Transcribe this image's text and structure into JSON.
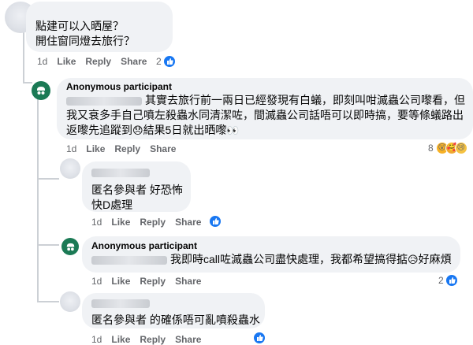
{
  "comments": [
    {
      "lines": [
        "點建可以入晒屋？",
        "開住窗同燈去旅行？"
      ],
      "actions": {
        "time": "1d",
        "like": "Like",
        "reply": "Reply",
        "share": "Share"
      },
      "reaction_count": "2",
      "reaction_icons": [
        "like-icon"
      ]
    },
    {
      "author": "Anonymous participant",
      "lines": [
        "其實去旅行前一兩日已經發現有白蟻，即刻叫咁滅蟲公司嚟看，但",
        "我又衰多手自己噴左殺蟲水同清潔咗，間滅蟲公司話唔可以即時搞，要等條蟻路出",
        "返嚟先追蹤到",
        "結果5日就出晒嚟"
      ],
      "actions": {
        "time": "1d",
        "like": "Like",
        "reply": "Reply",
        "share": "Share"
      },
      "reaction_count": "8",
      "reaction_icons": [
        "wow-icon",
        "care-icon",
        "sad-icon"
      ]
    },
    {
      "lines": [
        "匿名參與者 好恐怖",
        "快D處理"
      ],
      "actions": {
        "time": "1d",
        "like": "Like",
        "reply": "Reply",
        "share": "Share"
      },
      "reaction_icons": [
        "like-icon"
      ]
    },
    {
      "author": "Anonymous participant",
      "lines": [
        "我即時call咗滅蟲公司盡快處理，我都希望搞得掂",
        "好麻煩"
      ],
      "actions": {
        "time": "1d",
        "like": "Like",
        "reply": "Reply",
        "share": "Share"
      },
      "reaction_count": "2",
      "reaction_icons": [
        "like-icon"
      ]
    },
    {
      "lines": [
        "匿名參與者 的確係唔可亂噴殺蟲水"
      ],
      "actions": {
        "time": "1d",
        "like": "Like",
        "reply": "Reply",
        "share": "Share"
      },
      "reaction_icons": [
        "like-icon"
      ]
    }
  ],
  "colors": {
    "like_blue": "#1877f2",
    "bubble_bg": "#f0f2f5",
    "anon_green": "#1b7a55",
    "meta_gray": "#65676b"
  }
}
